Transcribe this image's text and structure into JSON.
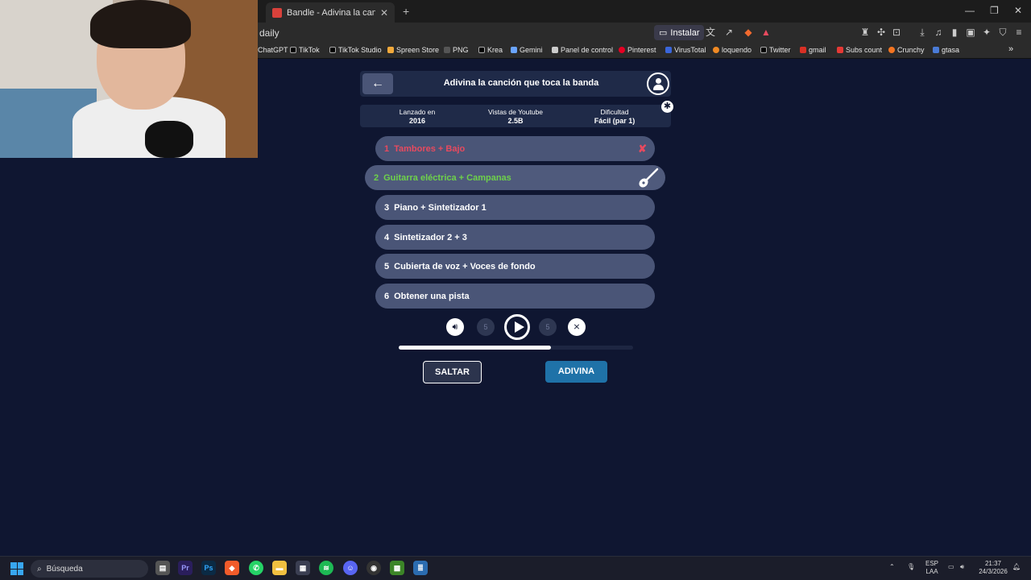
{
  "browser": {
    "tab_title": "Bandle - Adivina la canción, un i",
    "url_text": "daily",
    "install_label": "Instalar",
    "bookmarks": [
      "ChatGPT",
      "TikTok",
      "TikTok Studio",
      "Spreen Store",
      "PNG",
      "Krea",
      "Gemini",
      "Panel de control",
      "Pinterest",
      "VirusTotal",
      "loquendo",
      "Twitter",
      "gmail",
      "Subs count",
      "Crunchy",
      "gtasa"
    ]
  },
  "game": {
    "title": "Adivina la canción que toca la banda",
    "info": [
      {
        "label": "Lanzado en",
        "value": "2016"
      },
      {
        "label": "Vistas de Youtube",
        "value": "2.5B"
      },
      {
        "label": "Dificultad",
        "value": "Fácil (par 1)"
      }
    ],
    "steps": [
      {
        "num": "1",
        "label": "Tambores + Bajo",
        "state": "failed"
      },
      {
        "num": "2",
        "label": "Guitarra eléctrica + Campanas",
        "state": "active"
      },
      {
        "num": "3",
        "label": "Piano + Sintetizador 1",
        "state": "pending"
      },
      {
        "num": "4",
        "label": "Sintetizador 2 + 3",
        "state": "pending"
      },
      {
        "num": "5",
        "label": "Cubierta de voz + Voces de fondo",
        "state": "pending"
      },
      {
        "num": "6",
        "label": "Obtener una pista",
        "state": "pending"
      }
    ],
    "rewind_label": "5",
    "forward_label": "5",
    "progress": 0.65,
    "skip_label": "SALTAR",
    "guess_label": "ADIVINA"
  },
  "taskbar": {
    "search_placeholder": "Búsqueda",
    "lang_top": "ESP",
    "lang_bottom": "LAA",
    "time": "21:37",
    "date": "24/3/2026"
  },
  "colors": {
    "background": "#0f1631",
    "failed": "#e84a5f",
    "active": "#6ed24a",
    "guess_button": "#1f72a8"
  }
}
